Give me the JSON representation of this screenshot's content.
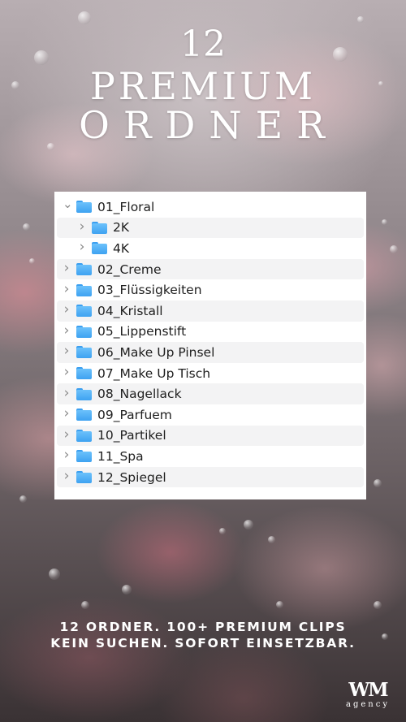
{
  "header": {
    "line1": "12",
    "line2": "PREMIUM",
    "line3": "ORDNER"
  },
  "folders": [
    {
      "label": "01_Floral",
      "expanded": true,
      "children": [
        {
          "label": "2K"
        },
        {
          "label": "4K"
        }
      ]
    },
    {
      "label": "02_Creme"
    },
    {
      "label": "03_Flüssigkeiten"
    },
    {
      "label": "04_Kristall"
    },
    {
      "label": "05_Lippenstift"
    },
    {
      "label": "06_Make Up Pinsel"
    },
    {
      "label": "07_Make Up Tisch"
    },
    {
      "label": "08_Nagellack"
    },
    {
      "label": "09_Parfuem"
    },
    {
      "label": "10_Partikel"
    },
    {
      "label": "11_Spa"
    },
    {
      "label": "12_Spiegel"
    }
  ],
  "tagline": {
    "line1": "12 ORDNER. 100+ PREMIUM CLIPS",
    "line2": "KEIN SUCHEN. SOFORT EINSETZBAR."
  },
  "brand": {
    "mark": "WM",
    "sub": "agency"
  },
  "colors": {
    "folder": "#4aaaf5",
    "chevron": "#8a8a8a",
    "panel": "#ffffff",
    "stripe": "#f3f3f4"
  },
  "icons": {
    "expanded": "chevron-down-icon",
    "collapsed": "chevron-right-icon",
    "folder": "folder-icon"
  }
}
